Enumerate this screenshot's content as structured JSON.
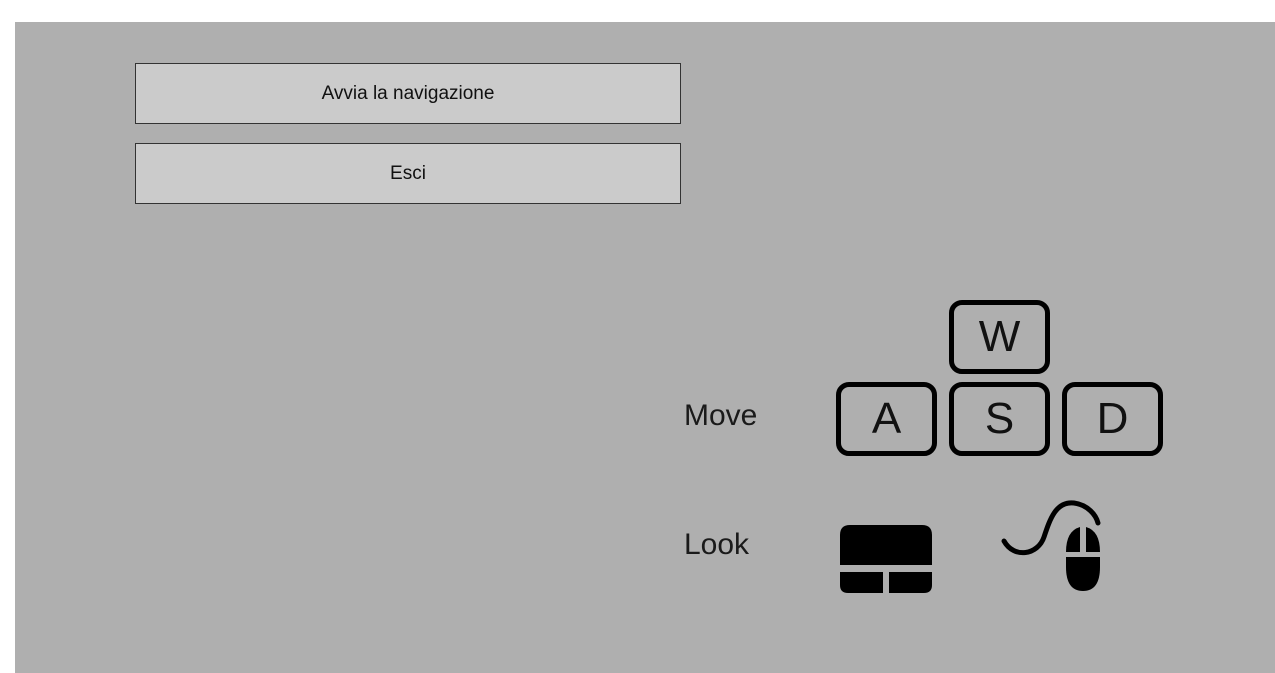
{
  "menu": {
    "start_label": "Avvia la navigazione",
    "exit_label": "Esci"
  },
  "controls": {
    "move_label": "Move",
    "look_label": "Look",
    "keys": {
      "w": "W",
      "a": "A",
      "s": "S",
      "d": "D"
    },
    "look_icons": [
      "touchpad-icon",
      "mouse-icon"
    ]
  },
  "colors": {
    "background": "#afafaf",
    "button": "#cbcbcb",
    "icon": "#000000"
  }
}
